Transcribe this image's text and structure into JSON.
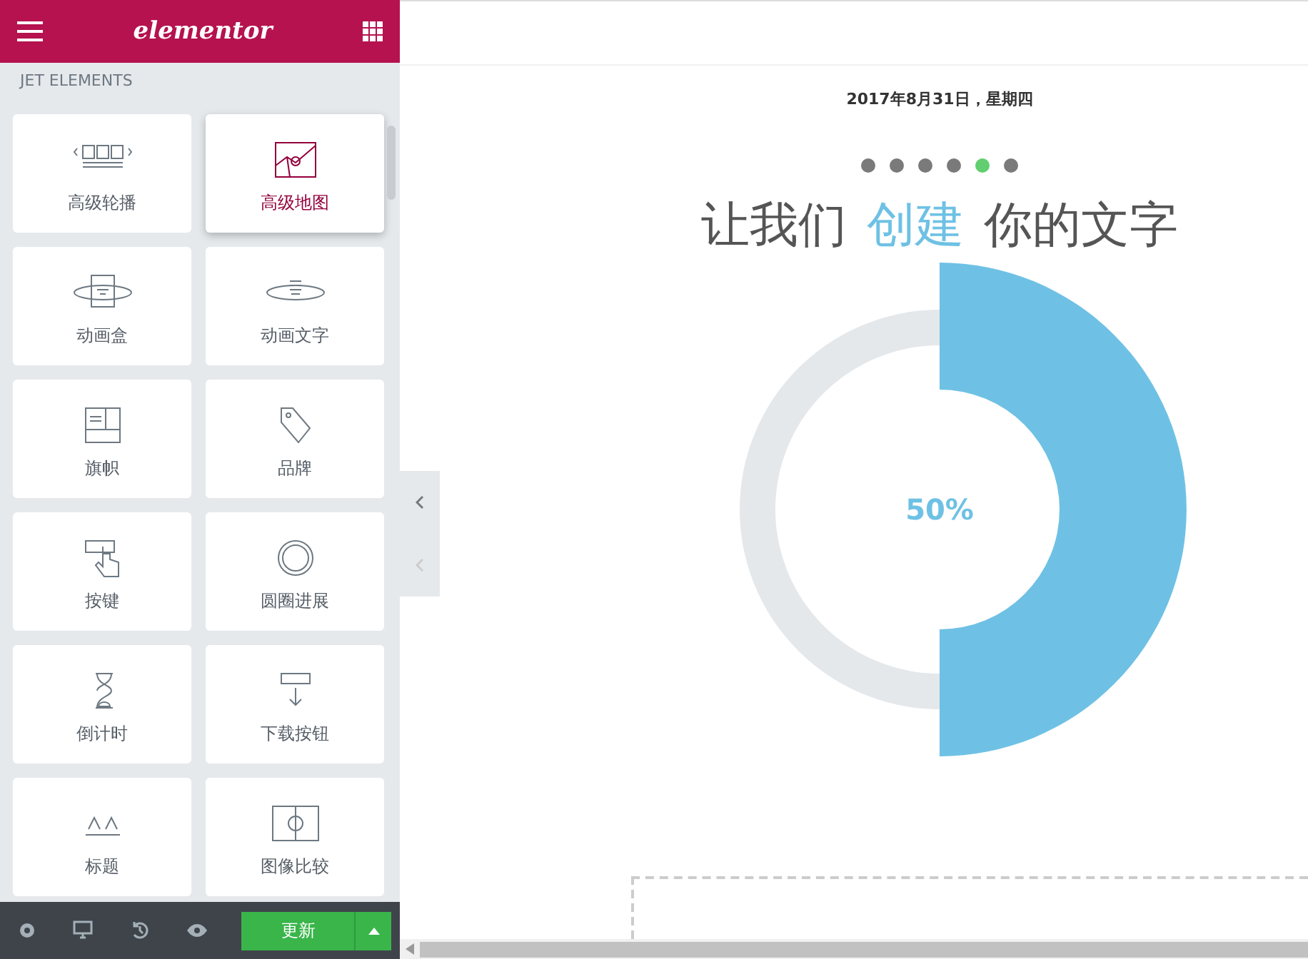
{
  "panel": {
    "logo": "elementor",
    "section_title": "JET ELEMENTS",
    "widgets": [
      {
        "label": "高级轮播",
        "highlighted": false
      },
      {
        "label": "高级地图",
        "highlighted": true
      },
      {
        "label": "动画盒",
        "highlighted": false
      },
      {
        "label": "动画文字",
        "highlighted": false
      },
      {
        "label": "旗帜",
        "highlighted": false
      },
      {
        "label": "品牌",
        "highlighted": false
      },
      {
        "label": "按键",
        "highlighted": false
      },
      {
        "label": "圆圈进展",
        "highlighted": false
      },
      {
        "label": "倒计时",
        "highlighted": false
      },
      {
        "label": "下载按钮",
        "highlighted": false
      },
      {
        "label": "标题",
        "highlighted": false
      },
      {
        "label": "图像比较",
        "highlighted": false
      }
    ],
    "footer": {
      "update_button": "更新"
    }
  },
  "preview": {
    "date": "2017年8月31日，星期四",
    "dots": [
      {
        "selected": false
      },
      {
        "selected": false
      },
      {
        "selected": false
      },
      {
        "selected": false
      },
      {
        "selected": true
      },
      {
        "selected": false
      }
    ],
    "headline": [
      {
        "text": "让我们",
        "accent": false
      },
      {
        "text": "创建",
        "accent": true
      },
      {
        "text": "你的文字",
        "accent": false
      }
    ],
    "progress": {
      "level": 0.5,
      "reading": "50%"
    }
  }
}
